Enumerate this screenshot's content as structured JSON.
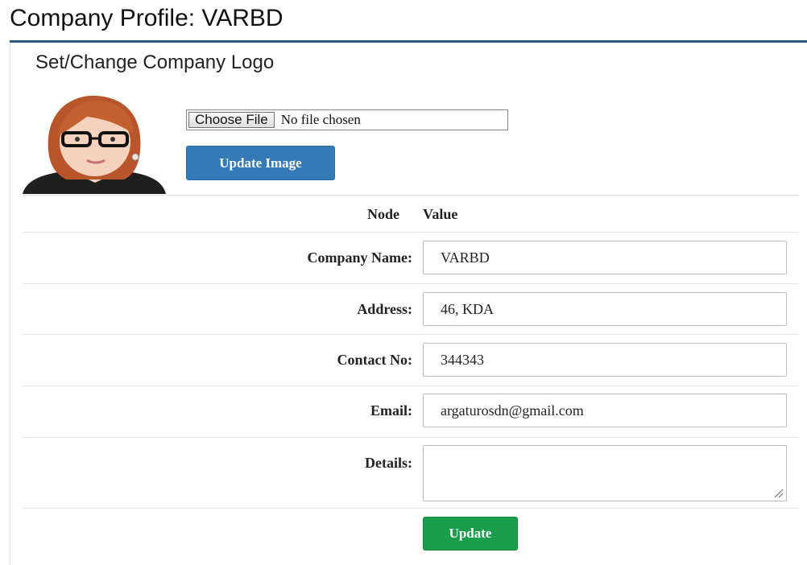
{
  "page": {
    "title": "Company Profile: VARBD"
  },
  "logo_section": {
    "title": "Set/Change Company Logo",
    "choose_file_label": "Choose File",
    "file_status": "No file chosen",
    "update_image_label": "Update Image"
  },
  "table": {
    "headers": {
      "node": "Node",
      "value": "Value"
    },
    "rows": [
      {
        "label": "Company Name:",
        "value": "VARBD"
      },
      {
        "label": "Address:",
        "value": "46, KDA"
      },
      {
        "label": "Contact No:",
        "value": "344343"
      },
      {
        "label": "Email:",
        "value": "argaturosdn@gmail.com"
      },
      {
        "label": "Details:",
        "value": ""
      }
    ],
    "update_label": "Update"
  },
  "colors": {
    "title_rule": "#2a5a86",
    "primary_button": "#337ab7",
    "success_button": "#1b9e4b"
  }
}
